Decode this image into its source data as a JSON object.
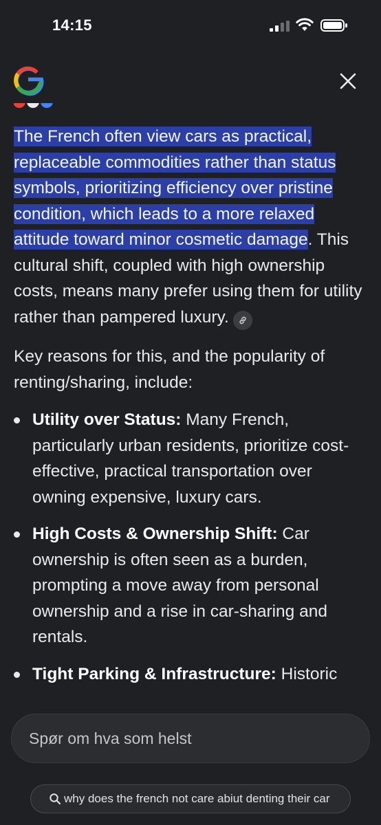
{
  "status_bar": {
    "time": "14:15"
  },
  "header": {
    "logo_icon": "google-g-icon",
    "close_icon": "close-icon"
  },
  "answer": {
    "highlighted": "The French often view cars as practical, replaceable commodities rather than status symbols, prioritizing efficiency over pristine condition, which leads to a more relaxed attitude toward minor cosmetic damage",
    "continuation": ". This cultural shift, coupled with high ownership costs, means many prefer using them for utility rather than pampered luxury.",
    "link_icon": "link-icon",
    "intro": "Key reasons for this, and the popularity of renting/sharing, include:",
    "bullets": [
      {
        "title": "Utility over Status:",
        "text": " Many French, particularly urban residents, prioritize cost-effective, practical transportation over owning expensive, luxury cars."
      },
      {
        "title": "High Costs & Ownership Shift:",
        "text": " Car ownership is often seen as a burden, prompting a move away from personal ownership and a rise in car-sharing and rentals."
      },
      {
        "title": "Tight Parking & Infrastructure:",
        "text": " Historic"
      }
    ]
  },
  "ask_bar": {
    "placeholder": "Spør om hva som helst"
  },
  "query_pill": {
    "icon": "search-icon",
    "text": "why does the french not care abiut denting their car"
  },
  "colors": {
    "background": "#1f2023",
    "highlight": "#2b3fa6",
    "text": "#e8eaed",
    "google_blue": "#4285F4",
    "google_red": "#EA4335",
    "google_yellow": "#FBBC05",
    "google_green": "#34A853"
  }
}
